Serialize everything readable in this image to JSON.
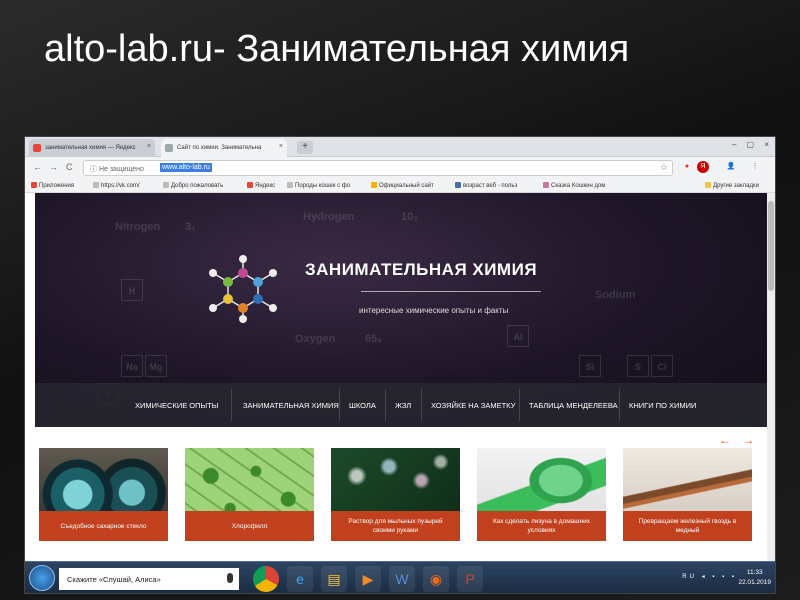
{
  "slide": {
    "title": "alto-lab.ru-  Занимательная химия"
  },
  "browser": {
    "tabs": [
      {
        "label": "занимательная химия — Яндекс",
        "active": false,
        "icon": "yandex-icon"
      },
      {
        "label": "Сайт по химии. Занимательна",
        "active": true,
        "icon": "page-icon"
      }
    ],
    "close_glyph": "×",
    "new_tab_glyph": "+",
    "window_controls": "– ▢ ×",
    "nav": {
      "back": "←",
      "forward": "→",
      "reload": "C"
    },
    "security_label": "ⓘ Не защищено",
    "url": "www.alto-lab.ru",
    "star_glyph": "☆",
    "extensions": [
      {
        "name": "record-icon",
        "glyph": "●",
        "color": "#d93025"
      },
      {
        "name": "yandex-ext-icon",
        "glyph": "Я",
        "color": "#c00"
      },
      {
        "name": "profile-icon",
        "glyph": "👤",
        "color": "#555"
      },
      {
        "name": "menu-icon",
        "glyph": "⋮",
        "color": "#555"
      }
    ],
    "bookmarks": [
      {
        "label": "Приложения",
        "color": "#e8453c"
      },
      {
        "label": "https://vk.com/",
        "color": "#bbb"
      },
      {
        "label": "Добро пожаловать",
        "color": "#bbb"
      },
      {
        "label": "Яндекс",
        "color": "#e8453c"
      },
      {
        "label": "Породы кошек с фо",
        "color": "#bbb"
      },
      {
        "label": "Официальный сайт",
        "color": "#f4b400"
      },
      {
        "label": "возраст веб - польз",
        "color": "#4a6fa5"
      },
      {
        "label": "Сказка Кошкин дом",
        "color": "#c27ba0"
      }
    ],
    "bookmarks_other": "Другие закладки"
  },
  "site": {
    "title": "ЗАНИМАТЕЛЬНАЯ ХИМИЯ",
    "tagline": "интересные химические опыты и факты",
    "background_words": [
      "Hydrogen",
      "Nitrogen",
      "Oxygen",
      "Sodium",
      "10₂",
      "3₁",
      "65₆"
    ],
    "background_elements": [
      "H",
      "Na",
      "Mg",
      "Al",
      "Si",
      "S",
      "Cl",
      "K"
    ],
    "menu": [
      "ХИМИЧЕСКИЕ ОПЫТЫ",
      "ЗАНИМАТЕЛЬНАЯ ХИМИЯ",
      "ШКОЛА",
      "ЖЗЛ",
      "ХОЗЯЙКЕ НА ЗАМЕТКУ",
      "ТАБЛИЦА МЕНДЕЛЕЕВА",
      "КНИГИ ПО ХИМИИ"
    ],
    "arrows": "← →",
    "cards": [
      {
        "caption": "Съедобное сахарное стекло",
        "image": "sugar-glass-image"
      },
      {
        "caption": "Хлорофилл",
        "image": "chlorophyll-image"
      },
      {
        "caption": "Раствор для мыльных пузырей своими руками",
        "image": "soap-bubbles-image"
      },
      {
        "caption": "Как сделать лизуна в домашних условиях",
        "image": "slime-image"
      },
      {
        "caption": "Превращаем железный гвоздь в медный",
        "image": "copper-nail-image"
      }
    ]
  },
  "taskbar": {
    "search_placeholder": "Скажите «Слушай, Алиса»",
    "apps": [
      "chrome-icon",
      "ie-icon",
      "explorer-icon",
      "media-icon",
      "word-icon",
      "firefox-icon",
      "powerpoint-icon"
    ],
    "lang": "RU",
    "time": "11:33",
    "date": "22.01.2019"
  },
  "colors": {
    "accent": "#c1411f",
    "hero_bg": "#1d1526",
    "url_highlight": "#3b7fe0"
  }
}
